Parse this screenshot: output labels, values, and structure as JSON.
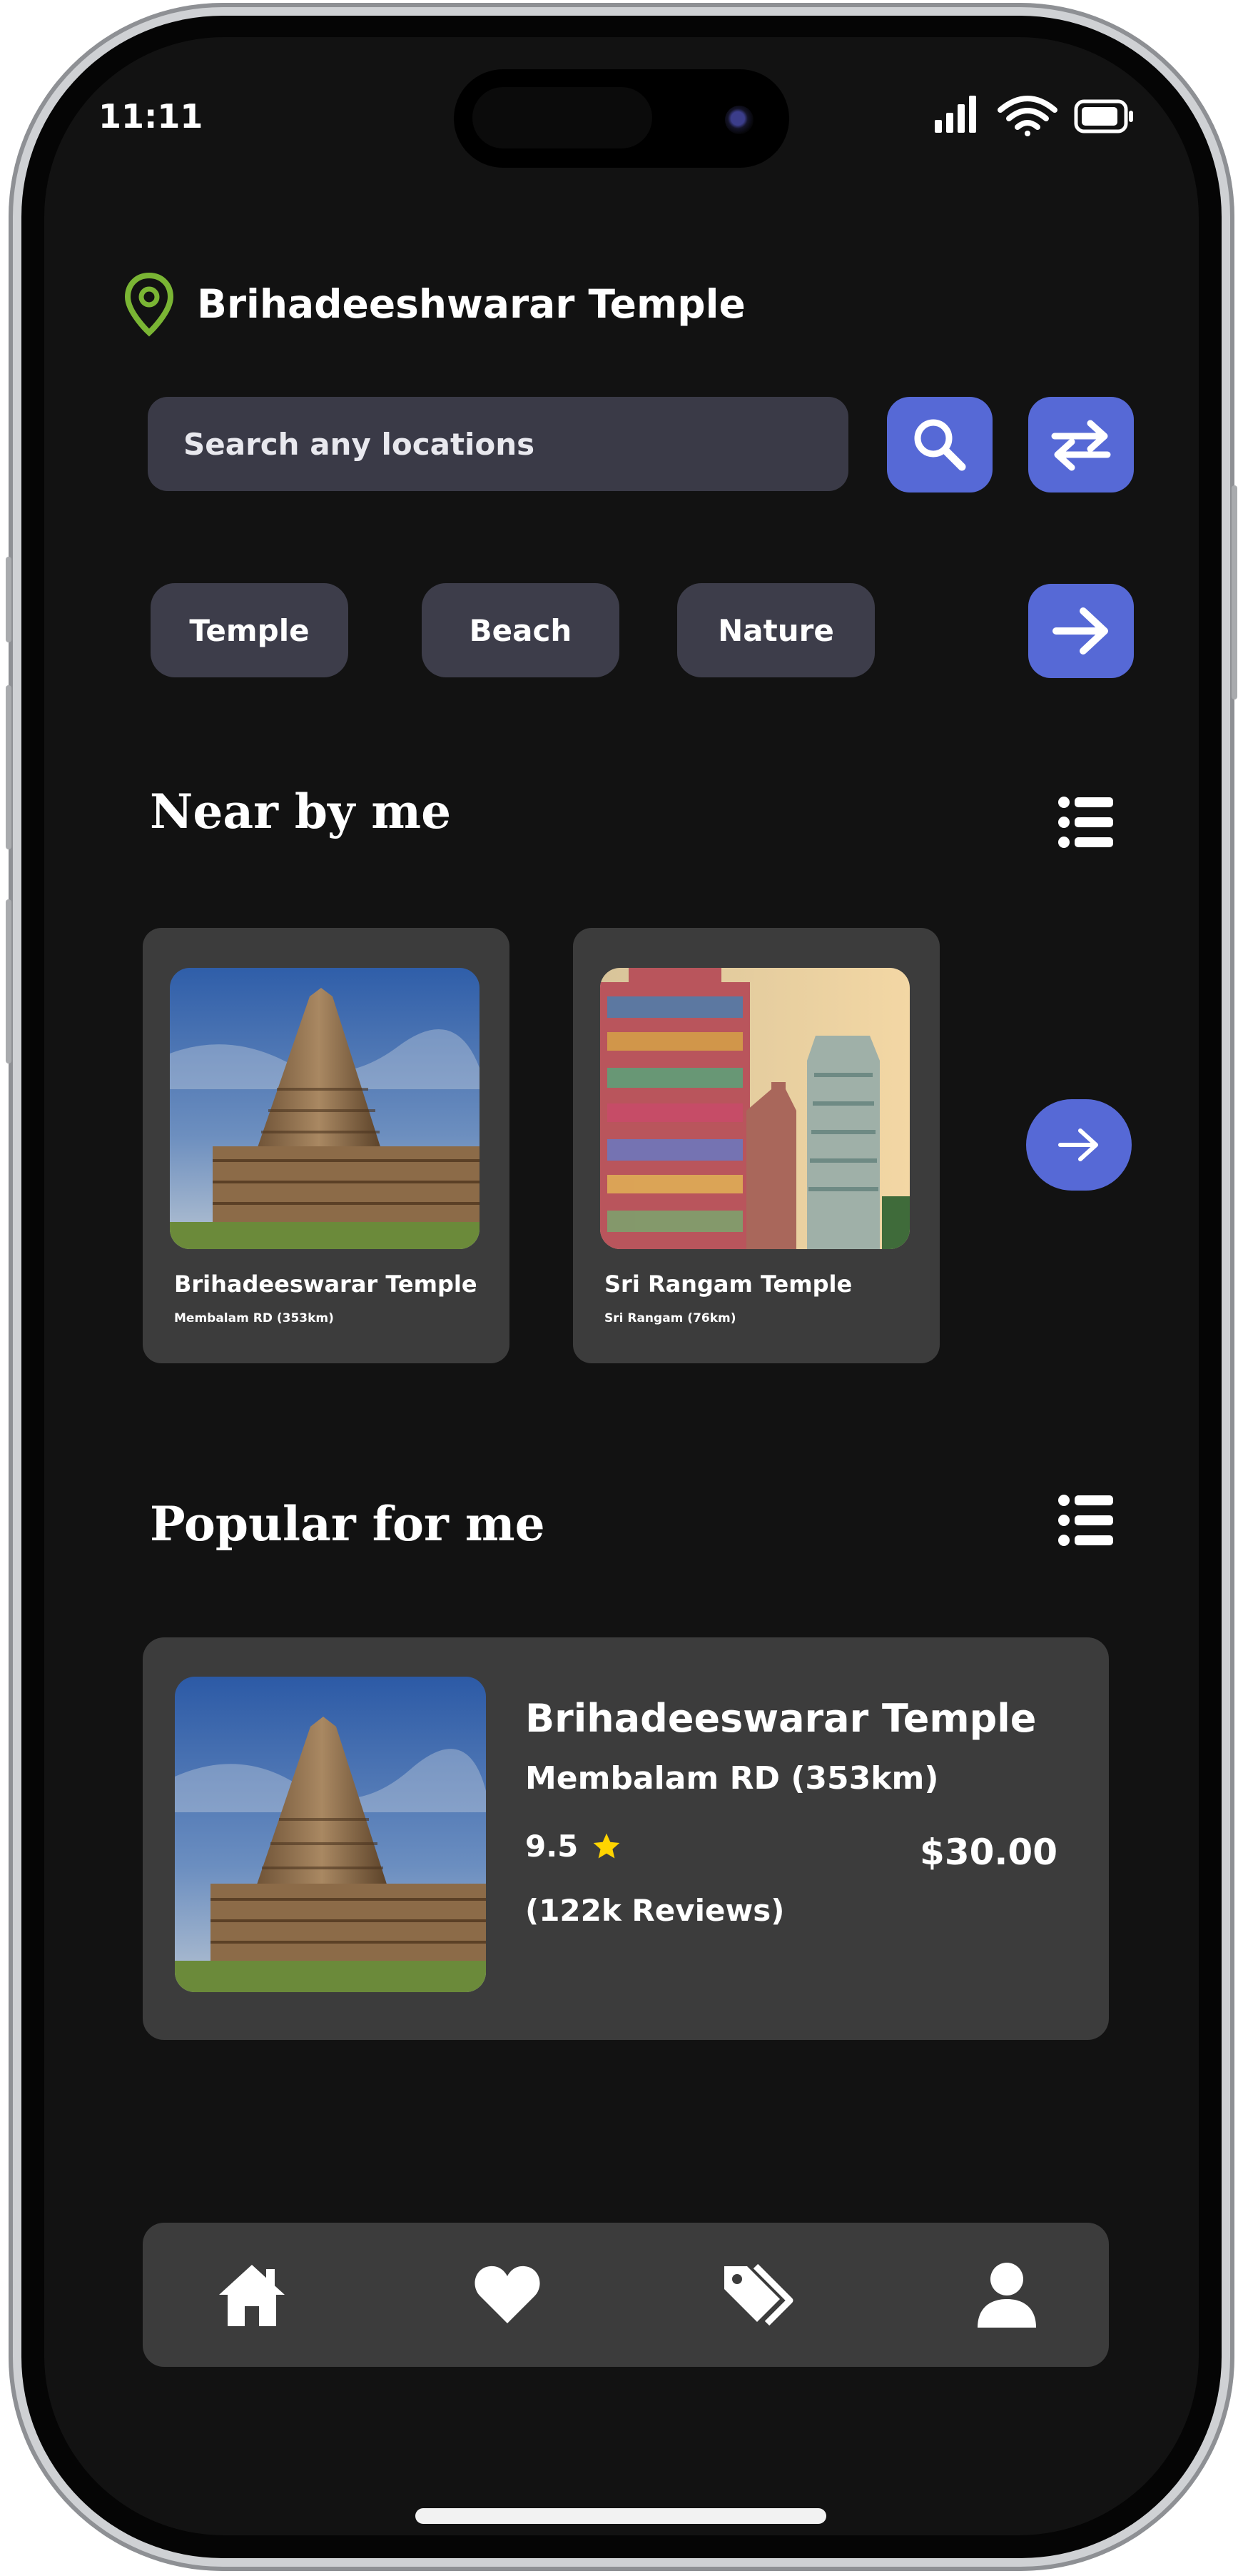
{
  "status_bar": {
    "time": "11:11"
  },
  "location": {
    "title": "Brihadeeshwarar Temple"
  },
  "search": {
    "placeholder": "Search any locations"
  },
  "categories": [
    "Temple",
    "Beach",
    "Nature"
  ],
  "nearby": {
    "title": "Near by me",
    "items": [
      {
        "name": "Brihadeeswarar Temple",
        "subtitle": "Membalam RD (353km)"
      },
      {
        "name": "Sri Rangam Temple",
        "subtitle": "Sri Rangam (76km)"
      }
    ]
  },
  "popular": {
    "title": "Popular for me",
    "items": [
      {
        "name": "Brihadeeswarar Temple",
        "address": "Membalam RD (353km)",
        "rating": "9.5",
        "reviews": "(122k Reviews)",
        "price": "$30.00"
      }
    ]
  },
  "colors": {
    "background": "#121212",
    "accent": "#5669d6",
    "card": "#3c3c3c",
    "chip": "#3d3d4a",
    "pin": "#7ab534",
    "star": "#ffd400"
  },
  "icons": {
    "location": "location-pin-icon",
    "search": "search-icon",
    "swap": "swap-icon",
    "more_categories": "arrow-right-icon",
    "list": "list-icon",
    "nav": [
      "home-icon",
      "heart-icon",
      "tags-icon",
      "user-icon"
    ]
  }
}
